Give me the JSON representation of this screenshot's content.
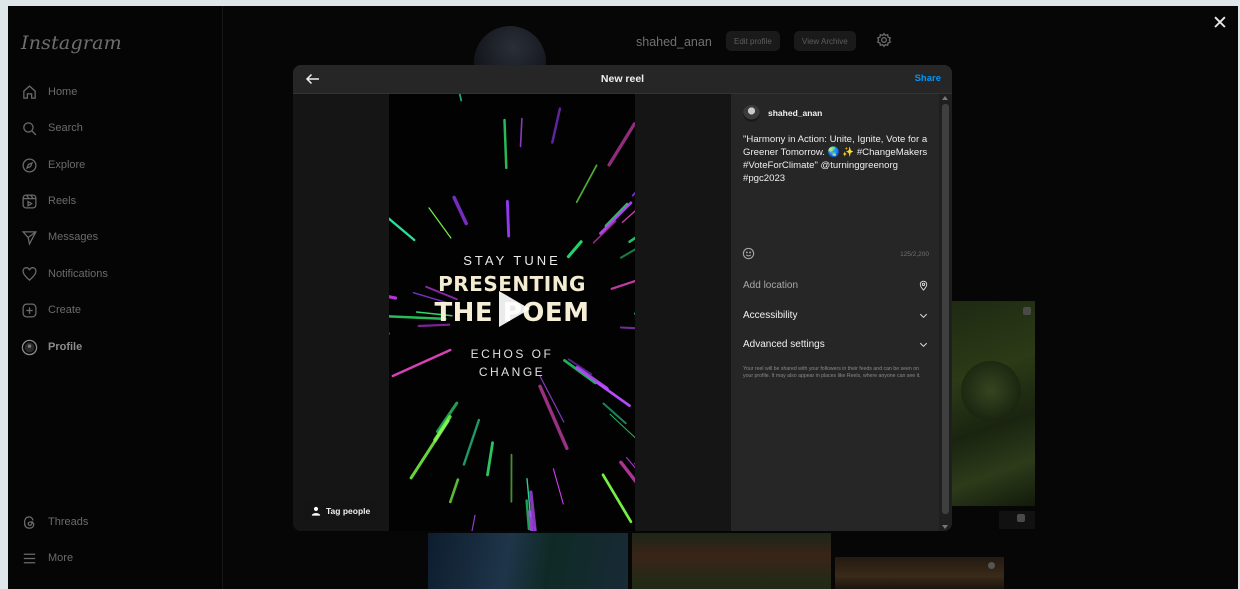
{
  "sidebar": {
    "logo": "Instagram",
    "items": [
      {
        "label": "Home",
        "icon": "home-icon"
      },
      {
        "label": "Search",
        "icon": "search-icon"
      },
      {
        "label": "Explore",
        "icon": "compass-icon"
      },
      {
        "label": "Reels",
        "icon": "reels-icon"
      },
      {
        "label": "Messages",
        "icon": "send-icon"
      },
      {
        "label": "Notifications",
        "icon": "heart-icon"
      },
      {
        "label": "Create",
        "icon": "plus-square-icon"
      },
      {
        "label": "Profile",
        "icon": "avatar-icon"
      }
    ],
    "threads_label": "Threads",
    "more_label": "More"
  },
  "profile_bg": {
    "username": "shahed_anan",
    "edit_profile": "Edit profile",
    "view_archive": "View Archive"
  },
  "modal": {
    "title": "New reel",
    "share": "Share",
    "tag_people": "Tag people",
    "video": {
      "line1": "STAY TUNE",
      "line2": "PRESENTING",
      "line3": "THE POEM",
      "line4": "ECHOS OF",
      "line5": "CHANGE"
    },
    "panel": {
      "username": "shahed_anan",
      "caption": "\"Harmony in Action: Unite, Ignite, Vote for a Greener Tomorrow. 🌏 ✨ #ChangeMakers #VoteForClimate\" @turninggreenorg #pgc2023",
      "char_count": "125/2,200",
      "add_location": "Add location",
      "accessibility": "Accessibility",
      "advanced_settings": "Advanced settings",
      "note": "Your reel will be shared with your followers in their feeds and can be seen on your profile. It may also appear in places like Reels, where anyone can see it."
    }
  },
  "colors": {
    "accent": "#0095f6",
    "modal_bg": "#262626",
    "page_bg": "#060606"
  }
}
